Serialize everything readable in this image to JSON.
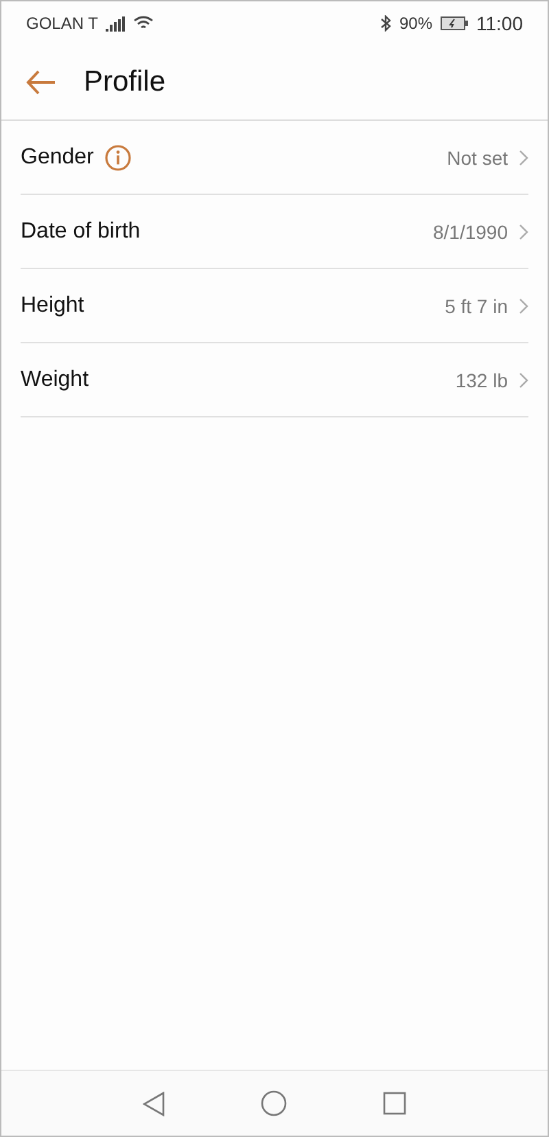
{
  "status_bar": {
    "carrier": "GOLAN T",
    "battery": "90%",
    "time": "11:00"
  },
  "header": {
    "title": "Profile"
  },
  "rows": [
    {
      "label": "Gender",
      "info": true,
      "value": "Not set"
    },
    {
      "label": "Date of birth",
      "info": false,
      "value": "8/1/1990"
    },
    {
      "label": "Height",
      "info": false,
      "value": "5 ft 7 in"
    },
    {
      "label": "Weight",
      "info": false,
      "value": "132 lb"
    }
  ]
}
